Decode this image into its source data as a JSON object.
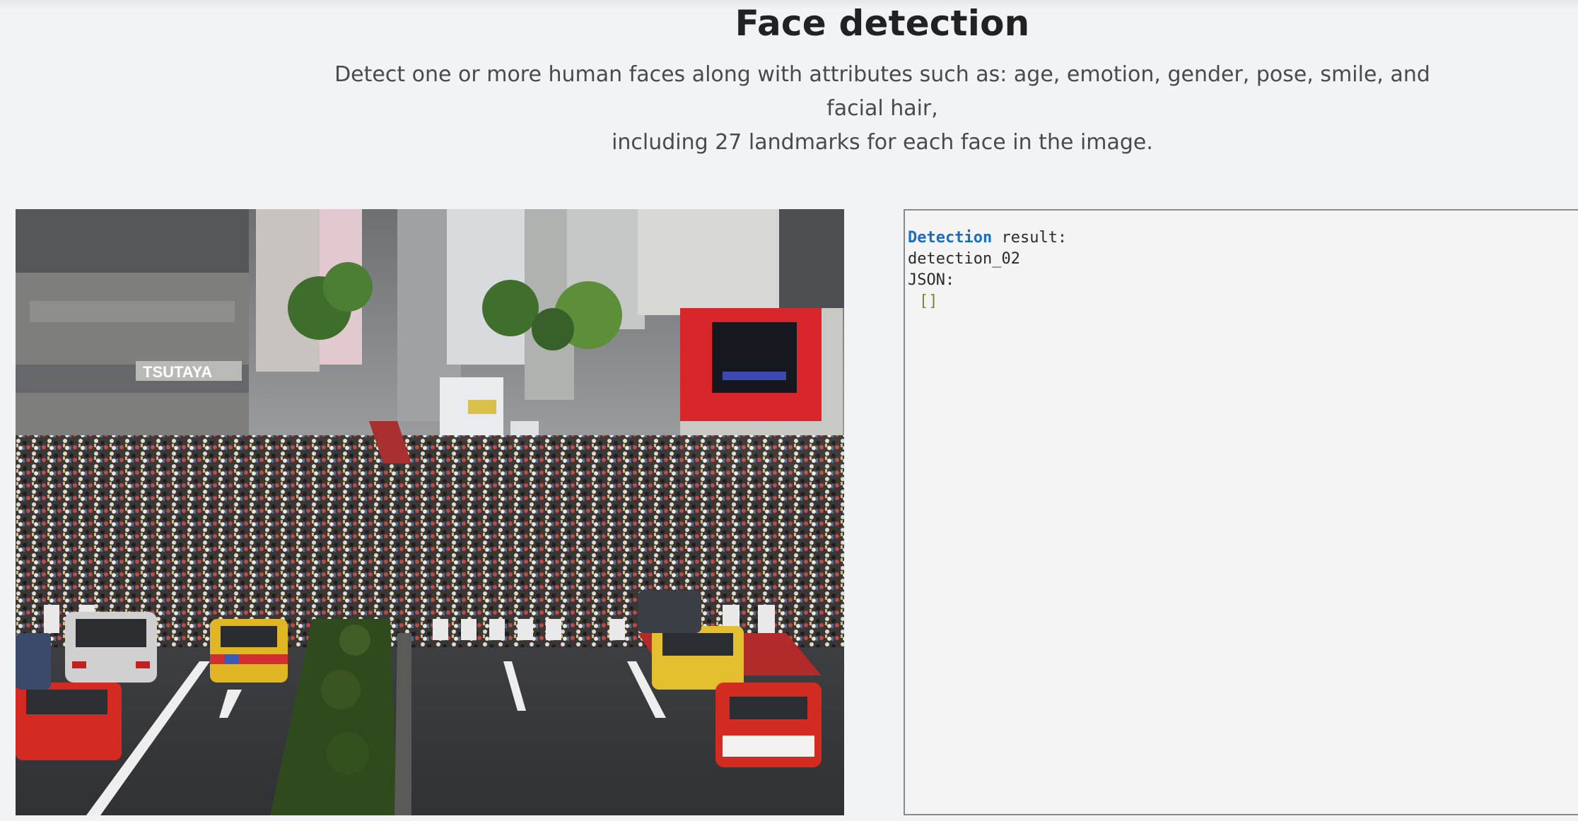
{
  "header": {
    "title": "Face detection",
    "description_line1": "Detect one or more human faces along with attributes such as: age, emotion, gender, pose, smile, and facial hair,",
    "description_line2": "including 27 landmarks for each face in the image."
  },
  "image": {
    "alt": "TSUTAYA"
  },
  "result": {
    "label_keyword": "Detection",
    "label_rest": " result:",
    "model": "detection_02",
    "json_label": "JSON:",
    "json_value": "[]"
  },
  "colors": {
    "background": "#f2f3f5",
    "keyword": "#1a6fc0",
    "json_value": "#7a8a2a"
  }
}
